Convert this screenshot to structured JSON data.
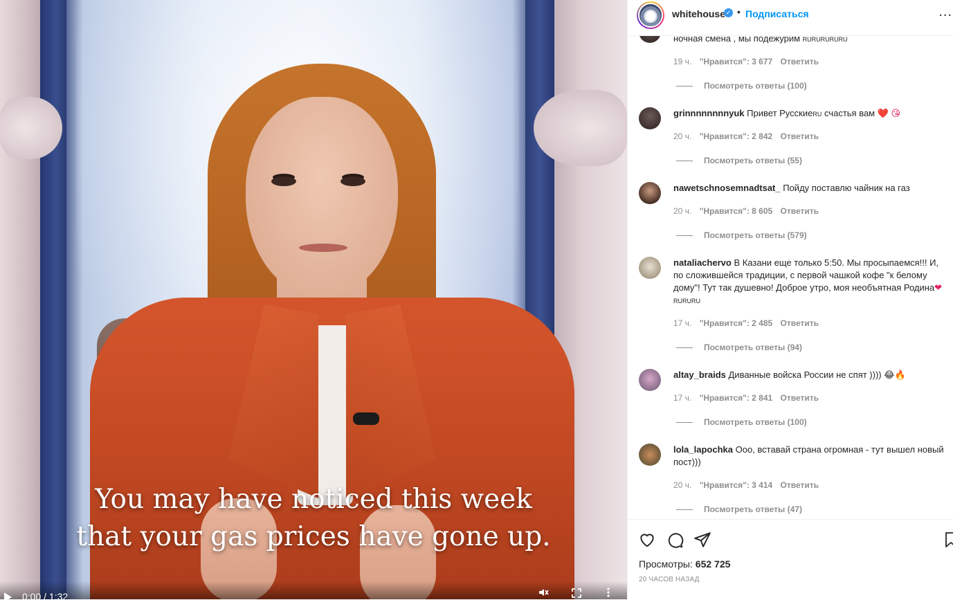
{
  "video": {
    "caption_line1": "You may have noticed this week",
    "caption_line2": "that your gas prices have gone up.",
    "time": "0:00 / 1:32"
  },
  "header": {
    "username": "whitehouse",
    "separator": "•",
    "follow_label": "Подписаться",
    "more": "..."
  },
  "comments": [
    {
      "username": "",
      "text": "ночная смена , мы подежурим",
      "tag": "RURURURURU",
      "time": "19 ч.",
      "likes": "\"Нравится\": 3 677",
      "reply": "Ответить",
      "replies": "Посмотреть ответы (100)"
    },
    {
      "username": "grinnnnnnnnyuk",
      "text": "Привет Русские",
      "tag": "RU",
      "text_after": " счастья вам",
      "emoji": "❤️ 😘",
      "time": "20 ч.",
      "likes": "\"Нравится\": 2 842",
      "reply": "Ответить",
      "replies": "Посмотреть ответы (55)"
    },
    {
      "username": "nawetschnosemnadtsat_",
      "text": "Пойду поставлю чайник на газ",
      "time": "20 ч.",
      "likes": "\"Нравится\": 8 605",
      "reply": "Ответить",
      "replies": "Посмотреть ответы (579)"
    },
    {
      "username": "nataliachervo",
      "text": "В Казани еще только 5:50. Мы просыпаемся!!! И, по сложившейся традиции, с первой чашкой кофе \"к белому дому\"! Тут так душевно! Доброе утро, моя необъятная Родина",
      "emoji": "❤",
      "tag": "RURURU",
      "time": "17 ч.",
      "likes": "\"Нравится\": 2 485",
      "reply": "Ответить",
      "replies": "Посмотреть ответы (94)"
    },
    {
      "username": "altay_braids",
      "text": "Диванные войска России не спят ))))",
      "emoji": "😂🔥",
      "time": "17 ч.",
      "likes": "\"Нравится\": 2 841",
      "reply": "Ответить",
      "replies": "Посмотреть ответы (100)"
    },
    {
      "username": "lola_lapochka",
      "text": "Ооо, вставай страна огромная - тут вышел новый пост)))",
      "time": "20 ч.",
      "likes": "\"Нравится\": 3 414",
      "reply": "Ответить",
      "replies": "Посмотреть ответы (47)"
    }
  ],
  "footer": {
    "views_label": "Просмотры:",
    "views_value": "652 725",
    "time_ago": "20 ЧАСОВ НАЗАД"
  },
  "colors": {
    "link_blue": "#0095f6",
    "muted": "#8e8e8e",
    "text": "#262626",
    "jacket": "#c44a23"
  },
  "icons": [
    "heart-icon",
    "comment-icon",
    "share-icon",
    "bookmark-icon",
    "verified-icon",
    "play-icon",
    "mute-icon",
    "fullscreen-icon",
    "more-icon"
  ]
}
